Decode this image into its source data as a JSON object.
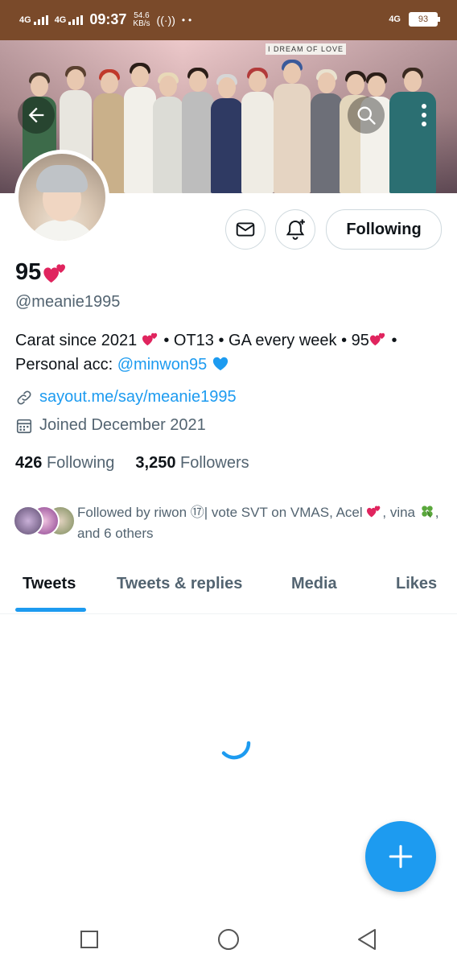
{
  "status_bar": {
    "signal1_label": "4G",
    "signal2_label": "4G",
    "time": "09:37",
    "speed_value": "54.6",
    "speed_unit": "KB/s",
    "network_right": "4G",
    "battery": "93"
  },
  "banner": {
    "sign_text": "I DREAM OF LOVE"
  },
  "actions": {
    "following_label": "Following"
  },
  "profile": {
    "name": "95",
    "handle": "@meanie1995",
    "bio_part1": "Carat since 2021",
    "bio_part2": " • OT13 • GA every week • 95",
    "bio_part3": " • Personal acc: ",
    "bio_mention": "@minwon95",
    "link": "sayout.me/say/meanie1995",
    "joined": "Joined December 2021",
    "following_count": "426",
    "following_label": "Following",
    "followers_count": "3,250",
    "followers_label": "Followers"
  },
  "followed_by": {
    "prefix": "Followed by riwon ⑰| vote SVT on VMAS, Acel ",
    "middle": ", vina ",
    "suffix": ", and 6 others"
  },
  "tabs": [
    {
      "label": "Tweets",
      "active": true
    },
    {
      "label": "Tweets & replies",
      "active": false
    },
    {
      "label": "Media",
      "active": false
    },
    {
      "label": "Likes",
      "active": false
    }
  ],
  "colors": {
    "accent": "#1d9bf0",
    "status_bar": "#7a4a2a",
    "secondary_text": "#536471"
  },
  "icons": {
    "back": "arrow-left-icon",
    "search": "search-icon",
    "more": "more-vertical-icon",
    "message": "envelope-icon",
    "notify": "bell-plus-icon",
    "link": "link-icon",
    "calendar": "calendar-icon",
    "compose": "plus-icon",
    "loading": "spinner-icon"
  }
}
